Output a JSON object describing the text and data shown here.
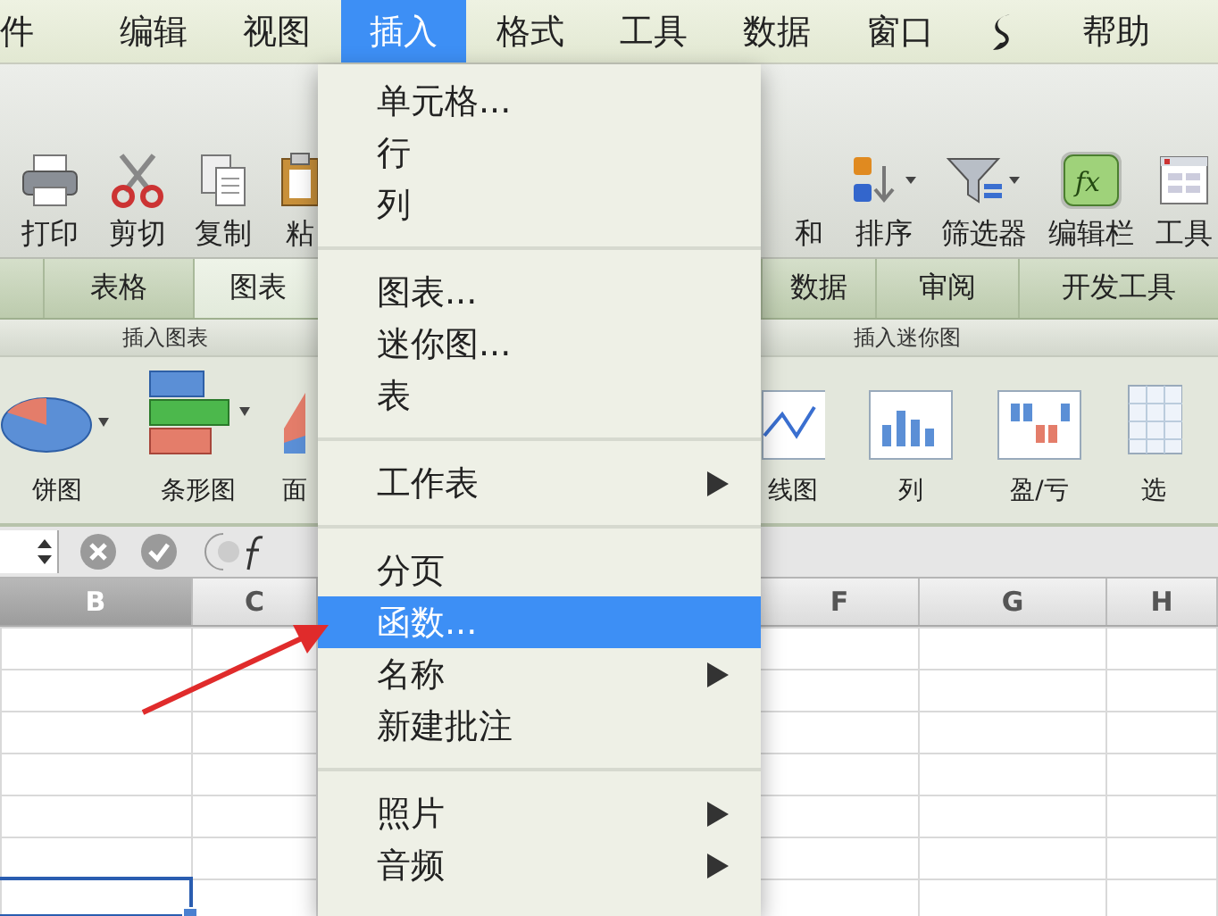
{
  "menu_bar": {
    "items": [
      {
        "kind": "text",
        "label": "件",
        "selected": false
      },
      {
        "kind": "text",
        "label": "编辑",
        "selected": false
      },
      {
        "kind": "text",
        "label": "视图",
        "selected": false
      },
      {
        "kind": "text",
        "label": "插入",
        "selected": true
      },
      {
        "kind": "text",
        "label": "格式",
        "selected": false
      },
      {
        "kind": "text",
        "label": "工具",
        "selected": false
      },
      {
        "kind": "text",
        "label": "数据",
        "selected": false
      },
      {
        "kind": "text",
        "label": "窗口",
        "selected": false
      },
      {
        "kind": "script-icon",
        "selected": false
      },
      {
        "kind": "text",
        "label": "帮助",
        "selected": false
      }
    ]
  },
  "toolbar": {
    "left": [
      {
        "kind": "printer",
        "label": "打印",
        "pressed": false
      },
      {
        "kind": "scissors",
        "label": "剪切",
        "pressed": false
      },
      {
        "kind": "copy",
        "label": "复制",
        "pressed": false
      },
      {
        "kind": "clipboard",
        "label": "粘",
        "pressed": false
      }
    ],
    "right": [
      {
        "kind": "none",
        "label": "和",
        "pressed": false
      },
      {
        "kind": "sort",
        "label": "排序",
        "pressed": false
      },
      {
        "kind": "filter",
        "label": "筛选器",
        "pressed": false
      },
      {
        "kind": "fx",
        "label": "编辑栏",
        "pressed": true
      },
      {
        "kind": "toolbox",
        "label": "工具",
        "pressed": false
      }
    ]
  },
  "ribbon_tabs": {
    "left": [
      {
        "label": "表格",
        "selected": false
      },
      {
        "label": "图表",
        "selected": true
      }
    ],
    "right": [
      {
        "label": "数据",
        "selected": false
      },
      {
        "label": "审阅",
        "selected": false
      },
      {
        "label": "开发工具",
        "selected": false
      }
    ]
  },
  "ribbon": {
    "groups": [
      {
        "title": "插入图表",
        "buttons": [
          {
            "kind": "pie",
            "label": "饼图"
          },
          {
            "kind": "bar",
            "label": "条形图"
          },
          {
            "kind": "area",
            "label": "面"
          }
        ]
      },
      {
        "title": "插入迷你图",
        "buttons": [
          {
            "kind": "line",
            "label": "线图"
          },
          {
            "kind": "column",
            "label": "列"
          },
          {
            "kind": "winloss",
            "label": "盈/亏"
          },
          {
            "kind": "select",
            "label": "选"
          }
        ]
      }
    ]
  },
  "sheet": {
    "columns": [
      {
        "label": "B",
        "selected": true
      },
      {
        "label": "C",
        "selected": false
      },
      {
        "label": "F",
        "selected": false
      },
      {
        "label": "G",
        "selected": false
      },
      {
        "label": "H",
        "selected": false
      }
    ]
  },
  "insert_menu": {
    "items": [
      {
        "kind": "item",
        "label": "单元格...",
        "submenu": false,
        "selected": false
      },
      {
        "kind": "item",
        "label": "行",
        "submenu": false,
        "selected": false
      },
      {
        "kind": "item",
        "label": "列",
        "submenu": false,
        "selected": false
      },
      {
        "kind": "separator"
      },
      {
        "kind": "item",
        "label": "图表...",
        "submenu": false,
        "selected": false
      },
      {
        "kind": "item",
        "label": "迷你图...",
        "submenu": false,
        "selected": false
      },
      {
        "kind": "item",
        "label": "表",
        "submenu": false,
        "selected": false
      },
      {
        "kind": "separator"
      },
      {
        "kind": "item",
        "label": "工作表",
        "submenu": true,
        "selected": false
      },
      {
        "kind": "separator"
      },
      {
        "kind": "item",
        "label": "分页",
        "submenu": false,
        "selected": false
      },
      {
        "kind": "item",
        "label": "函数...",
        "submenu": false,
        "selected": true
      },
      {
        "kind": "item",
        "label": "名称",
        "submenu": true,
        "selected": false
      },
      {
        "kind": "item",
        "label": "新建批注",
        "submenu": false,
        "selected": false
      },
      {
        "kind": "separator"
      },
      {
        "kind": "item",
        "label": "照片",
        "submenu": true,
        "selected": false
      },
      {
        "kind": "item",
        "label": "音频",
        "submenu": true,
        "selected": false
      }
    ]
  }
}
